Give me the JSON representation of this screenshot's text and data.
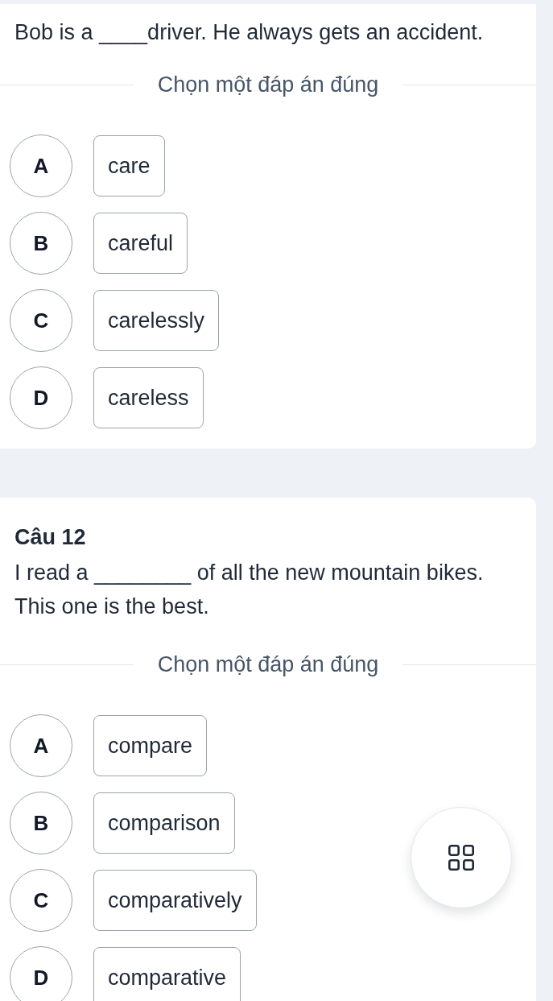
{
  "questions": [
    {
      "text_lines": [
        "Bob is a ____driver. He always gets an accident."
      ],
      "prompt": "Chọn một đáp án đúng",
      "options": [
        {
          "letter": "A",
          "text": "care",
          "selected": false
        },
        {
          "letter": "B",
          "text": "careful",
          "selected": false
        },
        {
          "letter": "C",
          "text": "carelessly",
          "selected": false
        },
        {
          "letter": "D",
          "text": "careless",
          "selected": false
        }
      ]
    },
    {
      "title": "Câu 12",
      "text_lines": [
        "I read a ________ of all the new mountain bikes.",
        "This one is the best."
      ],
      "prompt": "Chọn một đáp án đúng",
      "options": [
        {
          "letter": "A",
          "text": "compare",
          "selected": false
        },
        {
          "letter": "B",
          "text": "comparison",
          "selected": false
        },
        {
          "letter": "C",
          "text": "comparatively",
          "selected": false
        },
        {
          "letter": "D",
          "text": "comparative",
          "selected": false
        }
      ]
    }
  ]
}
